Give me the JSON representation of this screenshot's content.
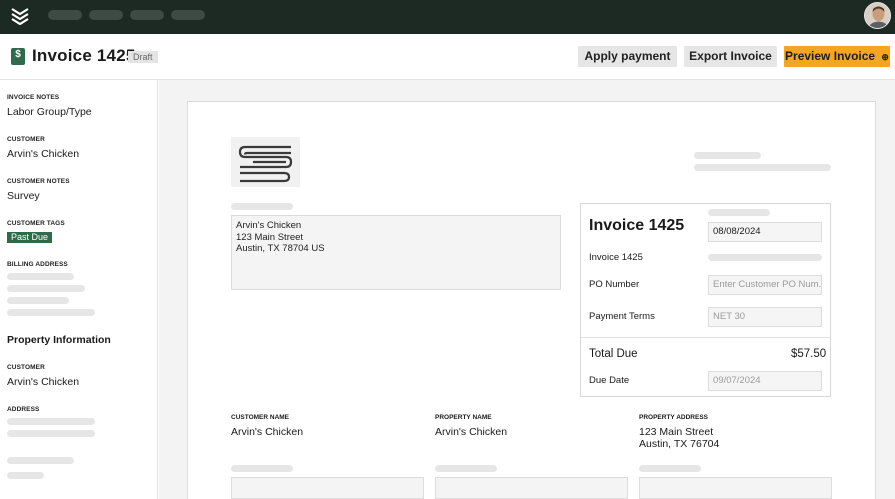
{
  "nav": {
    "logo_icon": "layers-icon",
    "avatar_icon": "user-avatar"
  },
  "header": {
    "title": "Invoice 1425",
    "status": "Draft",
    "apply_payment_label": "Apply payment",
    "export_label": "Export Invoice",
    "preview_label": "Preview Invoice",
    "preview_icon": "⊕",
    "doc_icon": "$"
  },
  "sidebar": {
    "invoice_notes_label": "Invoice Notes",
    "invoice_notes_value": "Labor Group/Type",
    "customer_label": "Customer",
    "customer_value": "Arvin's Chicken",
    "customer_notes_label": "Customer Notes",
    "customer_notes_value": "Survey",
    "customer_tags_label": "Customer Tags",
    "customer_tag": "Past Due",
    "billing_address_label": "Billing Address",
    "property_heading": "Property Information",
    "property_customer_label": "Customer",
    "property_customer_value": "Arvin's Chicken",
    "address_label": "Address"
  },
  "invoice": {
    "address_lines": [
      "Arvin's Chicken",
      "123 Main Street",
      "Austin, TX 78704 US"
    ],
    "card": {
      "title": "Invoice 1425",
      "date": "08/08/2024",
      "invoice_number": "Invoice 1425",
      "po_label": "PO Number",
      "po_placeholder": "Enter Customer PO Num...",
      "terms_label": "Payment Terms",
      "terms_value": "NET 30",
      "total_label": "Total Due",
      "total_value": "$57.50",
      "due_label": "Due Date",
      "due_value": "09/07/2024"
    },
    "customer_name_label": "Customer Name",
    "customer_name_value": "Arvin's Chicken",
    "property_name_label": "Property Name",
    "property_name_value": "Arvin's Chicken",
    "property_address_label": "Property Address",
    "property_address_line1": "123 Main Street",
    "property_address_line2": "Austin, TX 76704"
  },
  "colors": {
    "topbar": "#1c2a23",
    "accent_orange": "#f4a623",
    "tag_green": "#2f6b4a"
  }
}
